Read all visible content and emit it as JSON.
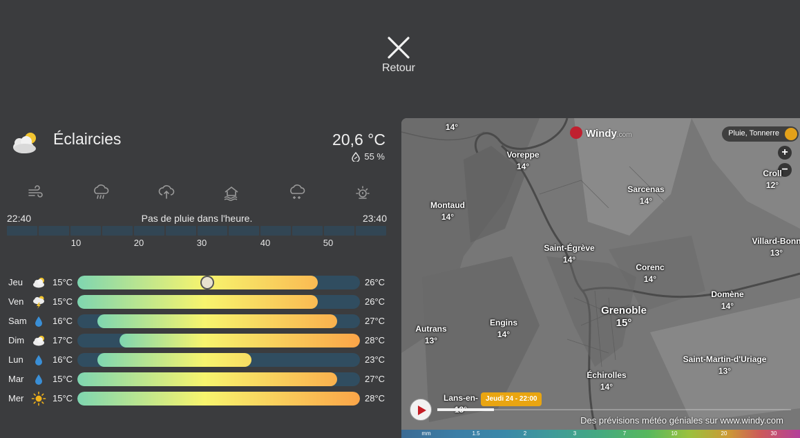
{
  "close": {
    "label": "Retour"
  },
  "current": {
    "condition": "Éclaircies",
    "temperature": "20,6 °C",
    "humidity": "55 %"
  },
  "attributes": [
    "wind-icon",
    "rain-cloud-icon",
    "cloud-upload-icon",
    "flood-house-icon",
    "snow-cloud-icon",
    "sun-alert-icon"
  ],
  "rain": {
    "start_time": "22:40",
    "message": "Pas de pluie dans l'heure.",
    "end_time": "23:40",
    "segments": 12,
    "ticks": [
      "10",
      "20",
      "30",
      "40",
      "50"
    ]
  },
  "forecast": [
    {
      "day": "Jeu",
      "icon": "partly-cloudy-icon",
      "min": "15°C",
      "max": "26°C",
      "bar_start": 0.0,
      "bar_end": 0.85,
      "now": 0.46
    },
    {
      "day": "Ven",
      "icon": "thunderstorm-icon",
      "min": "15°C",
      "max": "26°C",
      "bar_start": 0.0,
      "bar_end": 0.85
    },
    {
      "day": "Sam",
      "icon": "rain-drop-icon",
      "min": "16°C",
      "max": "27°C",
      "bar_start": 0.07,
      "bar_end": 0.92
    },
    {
      "day": "Dim",
      "icon": "partly-cloudy-icon",
      "min": "17°C",
      "max": "28°C",
      "bar_start": 0.15,
      "bar_end": 1.0
    },
    {
      "day": "Lun",
      "icon": "rain-drop-icon",
      "min": "16°C",
      "max": "23°C",
      "bar_start": 0.07,
      "bar_end": 0.615
    },
    {
      "day": "Mar",
      "icon": "rain-drop-icon",
      "min": "15°C",
      "max": "27°C",
      "bar_start": 0.0,
      "bar_end": 0.92
    },
    {
      "day": "Mer",
      "icon": "sun-icon",
      "min": "15°C",
      "max": "28°C",
      "bar_start": 0.0,
      "bar_end": 1.0
    }
  ],
  "map": {
    "brand": "Windy",
    "brand_domain": ".com",
    "layer": "Pluie, Tonnerre",
    "zoom_in": "+",
    "zoom_out": "−",
    "time_label": "Jeudi 24 - 22:00",
    "timeline_progress": 0.16,
    "credit_text": "Des prévisions météo géniales sur",
    "credit_link": "www.windy.com",
    "cities": [
      {
        "name": "",
        "temp": "14°"
      },
      {
        "name": "Voreppe",
        "temp": "14°"
      },
      {
        "name": "Sarcenas",
        "temp": "14°"
      },
      {
        "name": "Croll",
        "temp": "12°"
      },
      {
        "name": "Montaud",
        "temp": "14°"
      },
      {
        "name": "Saint-Égrève",
        "temp": "14°"
      },
      {
        "name": "Villard-Bonn",
        "temp": "13°"
      },
      {
        "name": "Corenc",
        "temp": "14°"
      },
      {
        "name": "Grenoble",
        "temp": "15°"
      },
      {
        "name": "Domène",
        "temp": "14°"
      },
      {
        "name": "Autrans",
        "temp": "13°"
      },
      {
        "name": "Engins",
        "temp": "14°"
      },
      {
        "name": "Saint-Martin-d'Uriage",
        "temp": "13°"
      },
      {
        "name": "Échirolles",
        "temp": "14°"
      },
      {
        "name": "Lans-en-",
        "temp": "13°"
      }
    ],
    "legend": [
      "mm",
      "1.5",
      "2",
      "3",
      "7",
      "10",
      "20",
      "30"
    ]
  }
}
